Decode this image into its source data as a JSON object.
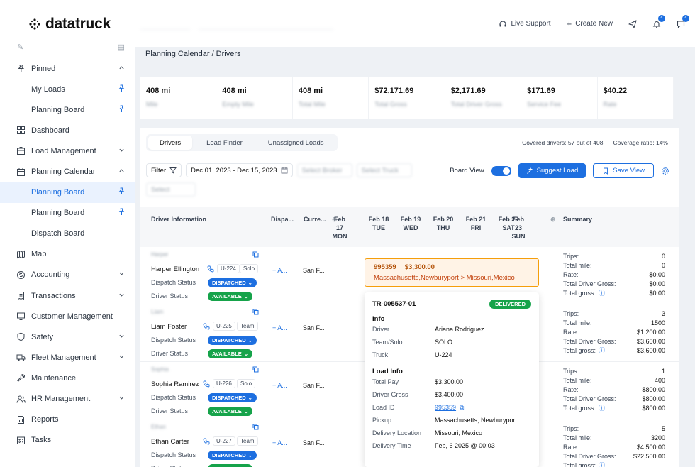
{
  "app": {
    "logo": "datatruck"
  },
  "sidebar": {
    "items": [
      {
        "label": "Pinned",
        "icon": "pin-icon",
        "tail": "chevron-up",
        "sub": false
      },
      {
        "label": "My Loads",
        "icon": "",
        "tail": "pin",
        "sub": true
      },
      {
        "label": "Planning Board",
        "icon": "",
        "tail": "pin",
        "sub": true
      },
      {
        "label": "Dashboard",
        "icon": "grid-icon",
        "tail": "",
        "sub": false
      },
      {
        "label": "Load Management",
        "icon": "box-icon",
        "tail": "chevron-down",
        "sub": false
      },
      {
        "label": "Planning Calendar",
        "icon": "calendar-icon",
        "tail": "chevron-up",
        "sub": false
      },
      {
        "label": "Planning Board",
        "icon": "",
        "tail": "pin",
        "sub": true,
        "active": true
      },
      {
        "label": "Planning Board",
        "icon": "",
        "tail": "pin",
        "sub": true
      },
      {
        "label": "Dispatch Board",
        "icon": "",
        "tail": "",
        "sub": true
      },
      {
        "label": "Map",
        "icon": "map-icon",
        "tail": "",
        "sub": false
      },
      {
        "label": "Accounting",
        "icon": "dollar-icon",
        "tail": "chevron-down",
        "sub": false
      },
      {
        "label": "Transactions",
        "icon": "receipt-icon",
        "tail": "chevron-down",
        "sub": false
      },
      {
        "label": "Customer Management",
        "icon": "monitor-icon",
        "tail": "",
        "sub": false
      },
      {
        "label": "Safety",
        "icon": "shield-icon",
        "tail": "chevron-down",
        "sub": false
      },
      {
        "label": "Fleet Management",
        "icon": "truck-icon",
        "tail": "chevron-down",
        "sub": false
      },
      {
        "label": "Maintenance",
        "icon": "wrench-icon",
        "tail": "",
        "sub": false
      },
      {
        "label": "HR Management",
        "icon": "users-icon",
        "tail": "chevron-down",
        "sub": false
      },
      {
        "label": "Reports",
        "icon": "report-icon",
        "tail": "",
        "sub": false
      },
      {
        "label": "Tasks",
        "icon": "tasks-icon",
        "tail": "",
        "sub": false
      }
    ]
  },
  "topbar": {
    "live_support": "Live Support",
    "create_new": "Create New",
    "notif_count": "4",
    "msg_count": "4"
  },
  "breadcrumb": "Planning Calendar  /  Drivers",
  "stats": [
    {
      "value": "408 mi",
      "label": "Mile"
    },
    {
      "value": "408 mi",
      "label": "Empty Mile"
    },
    {
      "value": "408 mi",
      "label": "Total Mile"
    },
    {
      "value": "$72,171.69",
      "label": "Total Gross"
    },
    {
      "value": "$2,171.69",
      "label": "Total Driver Gross"
    },
    {
      "value": "$171.69",
      "label": "Service Fee"
    },
    {
      "value": "$40.22",
      "label": "Rate"
    }
  ],
  "tabs": [
    "Drivers",
    "Load Finder",
    "Unassigned Loads"
  ],
  "covered": "Covered drivers: 57 out of 408",
  "coverage_ratio": "Coverage ratio: 14%",
  "filters": {
    "filter_label": "Filter",
    "date_range": "Dec 01, 2023 - Dec 15, 2023",
    "select1": "Select Broker",
    "select2": "Select Truck",
    "select3": "Select"
  },
  "controls": {
    "board_view": "Board View",
    "suggest_load": "Suggest Load",
    "save_view": "Save View"
  },
  "columns": {
    "driver_info": "Driver Information",
    "dispatcher": "Dispa...",
    "current": "Curre...",
    "summary": "Summary",
    "days": [
      {
        "l1": "Feb",
        "l2": "17",
        "l3": "MON"
      },
      {
        "l1": "Feb 18",
        "l2": "TUE",
        "l3": ""
      },
      {
        "l1": "Feb 19",
        "l2": "WED",
        "l3": ""
      },
      {
        "l1": "Feb 20",
        "l2": "THU",
        "l3": ""
      },
      {
        "l1": "Feb 21",
        "l2": "FRI",
        "l3": ""
      },
      {
        "l1": "Feb 22",
        "l2": "SAT",
        "l3": ""
      },
      {
        "l1": "Feb",
        "l2": "23",
        "l3": "SUN"
      }
    ]
  },
  "drivers": [
    {
      "id": "Harper",
      "name": "Harper Ellington",
      "unit": "U-224",
      "mode": "Solo",
      "dispatch": "DISPATCHED",
      "status": "AVAILABLE",
      "location": "San F...",
      "summary": [
        [
          "Trips:",
          "0"
        ],
        [
          "Total mile:",
          "0"
        ],
        [
          "Rate:",
          "$0.00"
        ],
        [
          "Total Driver Gross:",
          "$0.00"
        ],
        [
          "Total gross:",
          "$0.00"
        ]
      ]
    },
    {
      "id": "Liam",
      "name": "Liam Foster",
      "unit": "U-225",
      "mode": "Team",
      "dispatch": "DISPATCHED",
      "status": "AVAILABLE",
      "location": "San F...",
      "summary": [
        [
          "Trips:",
          "3"
        ],
        [
          "Total mile:",
          "1500"
        ],
        [
          "Rate:",
          "$1,200.00"
        ],
        [
          "Total Driver Gross:",
          "$3,600.00"
        ],
        [
          "Total gross:",
          "$3,600.00"
        ]
      ]
    },
    {
      "id": "Sophia",
      "name": "Sophia Ramirez",
      "unit": "U-226",
      "mode": "Solo",
      "dispatch": "DISPATCHED",
      "status": "AVAILABLE",
      "location": "San F...",
      "summary": [
        [
          "Trips:",
          "1"
        ],
        [
          "Total mile:",
          "400"
        ],
        [
          "Rate:",
          "$800.00"
        ],
        [
          "Total Driver Gross:",
          "$800.00"
        ],
        [
          "Total gross:",
          "$800.00"
        ]
      ]
    },
    {
      "id": "Ethan",
      "name": "Ethan Carter",
      "unit": "U-227",
      "mode": "Team",
      "dispatch": "DISPATCHED",
      "status": "AVAILABLE",
      "location": "San F...",
      "summary": [
        [
          "Trips:",
          "5"
        ],
        [
          "Total mile:",
          "3200"
        ],
        [
          "Rate:",
          "$4,500.00"
        ],
        [
          "Total Driver Gross:",
          "$22,500.00"
        ],
        [
          "Total gross:",
          ""
        ]
      ]
    }
  ],
  "row_labels": {
    "dispatch": "Dispatch Status",
    "driver": "Driver Status",
    "add": "A..."
  },
  "load_card": {
    "id": "995359",
    "amount": "$3,300.00",
    "route": "Massachusetts,Newburyport > Missouri,Mexico"
  },
  "popup": {
    "trip_id": "TR-005537-01",
    "status": "DELIVERED",
    "info_title": "Info",
    "info": [
      [
        "Driver",
        "Ariana Rodriguez"
      ],
      [
        "Team/Solo",
        "SOLO"
      ],
      [
        "Truck",
        "U-224"
      ]
    ],
    "load_title": "Load Info",
    "load": [
      [
        "Total Pay",
        "$3,300.00"
      ],
      [
        "Driver Gross",
        "$3,400.00"
      ],
      [
        "Load ID",
        "995359"
      ],
      [
        "Pickup",
        "Massachusetts, Newburyport"
      ],
      [
        "Delivery Location",
        "Missouri, Mexico"
      ],
      [
        "Delivery Time",
        "Feb, 6 2025 @ 00:03"
      ]
    ]
  }
}
